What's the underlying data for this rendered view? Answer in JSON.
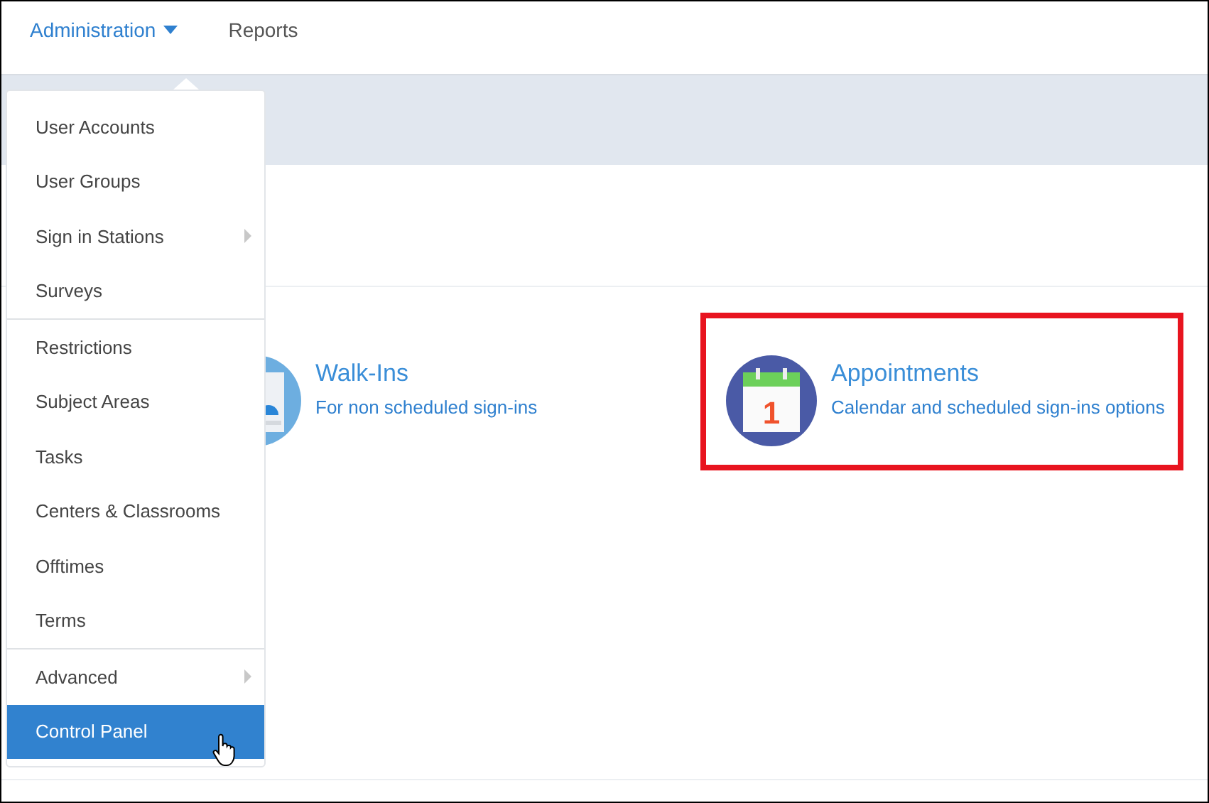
{
  "nav": [
    {
      "label": "Administration",
      "kind": "dropdown",
      "selected": true
    },
    {
      "label": "Reports",
      "kind": "link",
      "selected": false
    }
  ],
  "menu": {
    "groups": [
      [
        {
          "label": "User Accounts",
          "kind": "item",
          "selected": false
        },
        {
          "label": "User Groups",
          "kind": "item",
          "selected": false
        },
        {
          "label": "Sign in Stations",
          "kind": "submenu",
          "selected": false
        },
        {
          "label": "Surveys",
          "kind": "item",
          "selected": false
        }
      ],
      [
        {
          "label": "Restrictions",
          "kind": "item",
          "selected": false
        },
        {
          "label": "Subject Areas",
          "kind": "item",
          "selected": false
        },
        {
          "label": "Tasks",
          "kind": "item",
          "selected": false
        },
        {
          "label": "Centers & Classrooms",
          "kind": "item",
          "selected": false
        },
        {
          "label": "Offtimes",
          "kind": "item",
          "selected": false
        },
        {
          "label": "Terms",
          "kind": "item",
          "selected": false
        }
      ],
      [
        {
          "label": "Advanced",
          "kind": "submenu",
          "selected": false
        },
        {
          "label": "Control Panel",
          "kind": "item",
          "selected": true
        }
      ]
    ]
  },
  "cards": [
    {
      "kind": "walkins",
      "title": "Walk-Ins",
      "subtitle": "For non scheduled sign-ins",
      "highlighted": false
    },
    {
      "kind": "calendar",
      "title": "Appointments",
      "subtitle": "Calendar and scheduled sign-ins options",
      "day": "1",
      "highlighted": true
    }
  ]
}
